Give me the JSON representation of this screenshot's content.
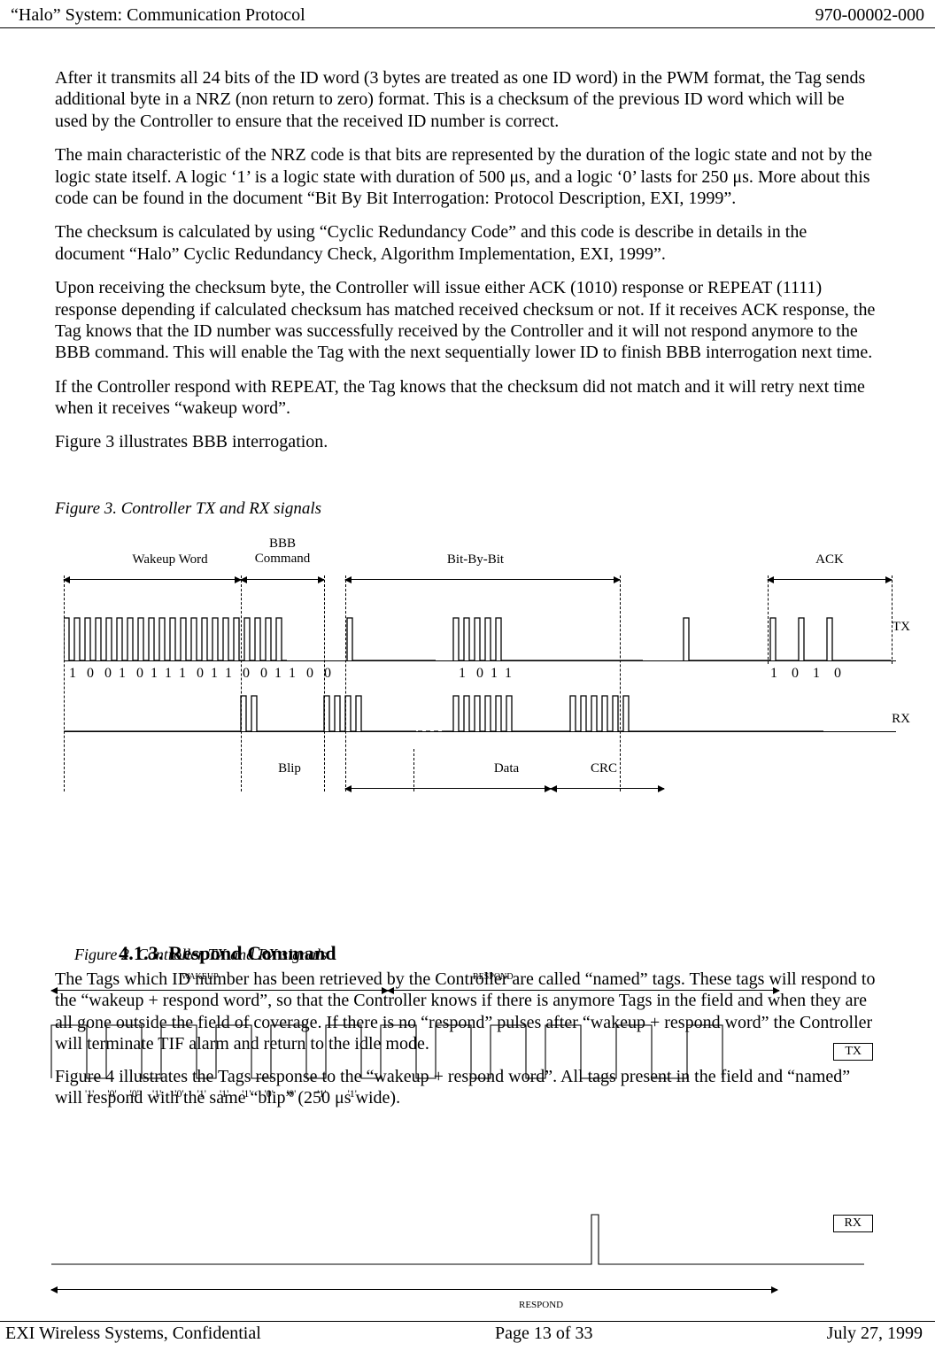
{
  "header": {
    "left": "“Halo” System: Communication Protocol",
    "right": "970-00002-000"
  },
  "footer": {
    "left": "EXI Wireless Systems, Confidential",
    "center": "Page 13 of 33",
    "right": "July 27, 1999"
  },
  "body": {
    "p1": "After it transmits all 24 bits of the ID word (3 bytes are treated as one ID word) in the PWM format, the Tag sends additional byte in a NRZ (non return to zero) format. This is a checksum of the previous ID word which will be used by the Controller to ensure that the received ID number is correct.",
    "p2": "The main characteristic of the NRZ code is that bits are represented by the duration of the logic state and not by the logic state itself. A logic ‘1’ is a logic state with duration of 500 μs, and a logic ‘0’ lasts for 250 μs. More about this code can be found in the document  “Bit By Bit Interrogation: Protocol Description, EXI, 1999”.",
    "p3": "The checksum is calculated by using “Cyclic Redundancy Code” and this code is describe in details in the document “Halo” Cyclic Redundancy Check, Algorithm Implementation, EXI, 1999”.",
    "p4": "Upon receiving the checksum byte, the Controller will issue either ACK (1010) response or REPEAT (1111) response depending if calculated checksum has matched received checksum or not. If it receives ACK response, the Tag knows that the ID number was successfully received by the Controller and it will not respond anymore to the BBB command. This will enable the Tag with the next sequentially lower ID to finish BBB interrogation next time.",
    "p5": "If the Controller respond with REPEAT, the Tag knows that the checksum did not match and it will retry next time when it receives “wakeup word”.",
    "p6": "Figure 3 illustrates BBB interrogation."
  },
  "fig3": {
    "caption": "Figure 3. Controller TX and RX signals",
    "labels": {
      "wakeup": "Wakeup Word",
      "bbb": "BBB\nCommand",
      "bitbybit": "Bit-By-Bit",
      "ack": "ACK",
      "tx": "TX",
      "rx": "RX",
      "blip": "Blip",
      "data": "Data",
      "crc": "CRC"
    },
    "bits_row1_a": "1   0   0  1   0  1  1  1   0  1  1   0   0  1  1   0   0",
    "bits_row1_b": "1   0  1  1",
    "bits_row1_c": "1    0    1    0"
  },
  "fig2": {
    "caption": "Figure 2. Controller TX and RX signals",
    "labels": {
      "wakeup": "WAKEUP",
      "respond": "RESPOND",
      "tx": "TX",
      "rx": "RX",
      "respond2": "RESPOND"
    },
    "bits": "'1'     '0'     '0'     '1'     '0'     '1'     '1'     '1'     '0'     '0'        '1'        '1'"
  },
  "sec413": {
    "head": "4.1.3.  Respond Command",
    "p1": "The Tags which ID number has been retrieved by the Controller are called “named” tags. These tags will respond to the “wakeup + respond word”, so that the Controller knows if there is anymore Tags in the field and when they are all gone outside the field of coverage. If there is no “respond” pulses after “wakeup + respond word” the Controller will terminate TIF alarm and return to the idle mode.",
    "p2": "Figure 4 illustrates the Tags response to the “wakeup + respond word”. All tags present in the field and “named” will respond with the same “blip” (250 μs wide)."
  }
}
